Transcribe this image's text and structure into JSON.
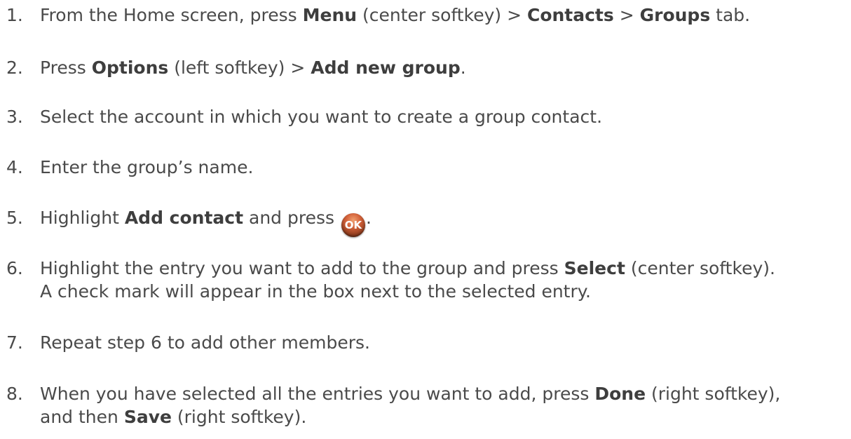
{
  "steps": [
    {
      "num": "1.",
      "parts": [
        {
          "t": "From the Home screen, press "
        },
        {
          "t": "Menu",
          "b": true
        },
        {
          "t": " (center softkey) > "
        },
        {
          "t": "Contacts",
          "b": true
        },
        {
          "t": " > "
        },
        {
          "t": "Groups",
          "b": true
        },
        {
          "t": " tab."
        }
      ]
    },
    {
      "num": "2.",
      "parts": [
        {
          "t": "Press "
        },
        {
          "t": "Options",
          "b": true
        },
        {
          "t": " (left softkey) > "
        },
        {
          "t": "Add new group",
          "b": true
        },
        {
          "t": "."
        }
      ]
    },
    {
      "num": "3.",
      "parts": [
        {
          "t": "Select the account in which you want to create a group contact."
        }
      ]
    },
    {
      "num": "4.",
      "parts": [
        {
          "t": "Enter the group’s name."
        }
      ]
    },
    {
      "num": "5.",
      "parts": [
        {
          "t": "Highlight "
        },
        {
          "t": "Add contact",
          "b": true
        },
        {
          "t": " and press "
        },
        {
          "icon": "ok-button-icon",
          "label": "OK"
        },
        {
          "t": "."
        }
      ]
    },
    {
      "num": "6.",
      "parts": [
        {
          "t": "Highlight the entry you want to add to the group and press "
        },
        {
          "t": "Select",
          "b": true
        },
        {
          "t": " (center softkey)."
        }
      ],
      "line2": [
        {
          "t": "A check mark will appear in the box next to the selected entry."
        }
      ]
    },
    {
      "num": "7.",
      "parts": [
        {
          "t": "Repeat step 6 to add other members."
        }
      ]
    },
    {
      "num": "8.",
      "parts": [
        {
          "t": "When you have selected all the entries you want to add, press "
        },
        {
          "t": "Done",
          "b": true
        },
        {
          "t": " (right softkey),"
        }
      ],
      "line2": [
        {
          "t": "and then "
        },
        {
          "t": "Save",
          "b": true
        },
        {
          "t": " (right softkey)."
        }
      ]
    }
  ]
}
